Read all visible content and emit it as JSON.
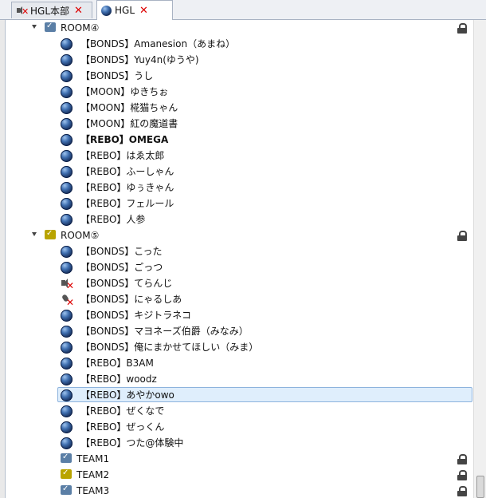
{
  "tabs": [
    {
      "label": "HGL本部",
      "icon": "muted-speaker-icon",
      "close": "✕",
      "active": false
    },
    {
      "label": "HGL",
      "icon": "blue-ball-icon",
      "close": "✕",
      "active": true
    }
  ],
  "colors": {
    "room_blue": "#5b7fa6",
    "room_gold": "#b9a400",
    "selection_fill": "#dfeefc",
    "selection_border": "#8db3dd",
    "close_red": "#dd0000"
  },
  "rooms": [
    {
      "name": "ROOM④",
      "icon_color": "room_blue",
      "locked": true,
      "expanded": true,
      "members": [
        {
          "name": "【BONDS】Amanesion（あまね）",
          "status": "online"
        },
        {
          "name": "【BONDS】Yuy4n(ゆうや)",
          "status": "online"
        },
        {
          "name": "【BONDS】うし",
          "status": "online"
        },
        {
          "name": "【MOON】ゆきちぉ",
          "status": "online"
        },
        {
          "name": "【MOON】椛猫ちゃん",
          "status": "online"
        },
        {
          "name": "【MOON】紅の魔道書",
          "status": "online"
        },
        {
          "name": "【REBO】OMEGA",
          "status": "online",
          "bold": true
        },
        {
          "name": "【REBO】はゑ太郎",
          "status": "online"
        },
        {
          "name": "【REBO】ふーしゃん",
          "status": "online"
        },
        {
          "name": "【REBO】ゆぅきゃん",
          "status": "online"
        },
        {
          "name": "【REBO】フェルール",
          "status": "online"
        },
        {
          "name": "【REBO】人参",
          "status": "online"
        }
      ]
    },
    {
      "name": "ROOM⑤",
      "icon_color": "room_gold",
      "locked": true,
      "expanded": true,
      "members": [
        {
          "name": "【BONDS】こった",
          "status": "online"
        },
        {
          "name": "【BONDS】ごっつ",
          "status": "online"
        },
        {
          "name": "【BONDS】てらんじ",
          "status": "muted"
        },
        {
          "name": "【BONDS】にゃるしあ",
          "status": "mic-off"
        },
        {
          "name": "【BONDS】キジトラネコ",
          "status": "online"
        },
        {
          "name": "【BONDS】マヨネーズ伯爵（みなみ）",
          "status": "online"
        },
        {
          "name": "【BONDS】俺にまかせてほしい（みま）",
          "status": "online"
        },
        {
          "name": "【REBO】B3AM",
          "status": "online"
        },
        {
          "name": "【REBO】woodz",
          "status": "online"
        },
        {
          "name": "【REBO】あやかowo",
          "status": "online",
          "selected": true
        },
        {
          "name": "【REBO】ぜくなで",
          "status": "online"
        },
        {
          "name": "【REBO】ぜっくん",
          "status": "online"
        },
        {
          "name": "【REBO】つた@体験中",
          "status": "online"
        }
      ]
    },
    {
      "name": "TEAM1",
      "icon_color": "room_blue",
      "locked": true,
      "expanded": false,
      "members": []
    },
    {
      "name": "TEAM2",
      "icon_color": "room_gold",
      "locked": true,
      "expanded": false,
      "members": []
    },
    {
      "name": "TEAM3",
      "icon_color": "room_blue",
      "locked": true,
      "expanded": false,
      "members": []
    }
  ]
}
